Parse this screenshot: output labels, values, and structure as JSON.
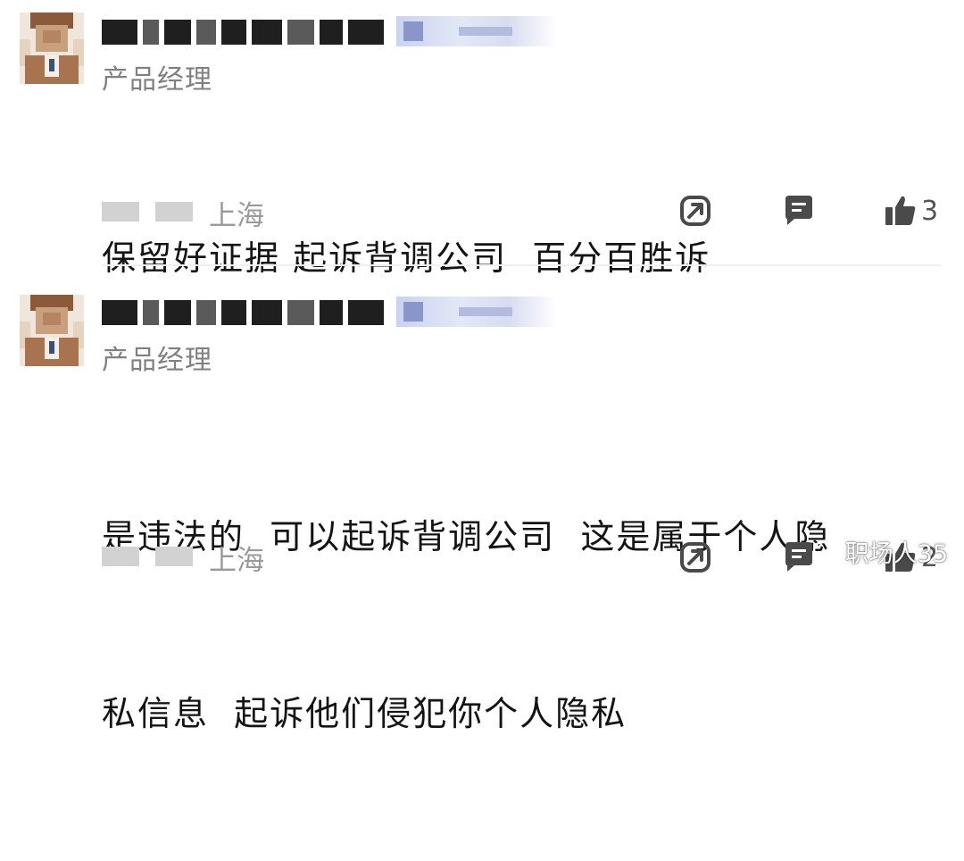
{
  "comments": [
    {
      "role": "产品经理",
      "lines": [
        "保留好证据 起诉背调公司  百分百胜诉"
      ],
      "location": "上海",
      "like_count": "3"
    },
    {
      "role": "产品经理",
      "lines": [
        "是违法的  可以起诉背调公司  这是属于个人隐",
        "私信息  起诉他们侵犯你个人隐私"
      ],
      "location": "上海",
      "like_count": "2"
    }
  ],
  "watermark": {
    "text": "职场人35"
  },
  "colors": {
    "text": "#141414",
    "muted": "#808080",
    "icon": "#4a4a4a"
  }
}
